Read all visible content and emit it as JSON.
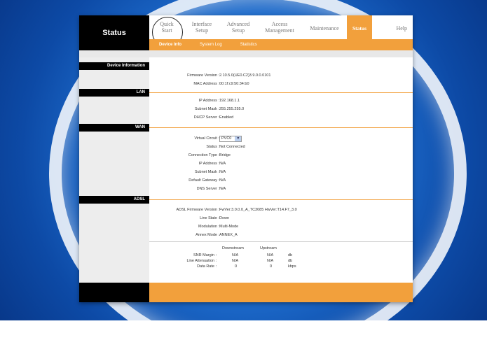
{
  "header": {
    "status_box": "Status",
    "tabs": [
      {
        "line1": "Quick",
        "line2": "Start"
      },
      {
        "line1": "Interface",
        "line2": "Setup"
      },
      {
        "line1": "Advanced",
        "line2": "Setup"
      },
      {
        "line1": "Access",
        "line2": "Management"
      },
      {
        "line1": "Maintenance",
        "line2": ""
      },
      {
        "line1": "Status",
        "line2": ""
      },
      {
        "line1": "Help",
        "line2": ""
      }
    ],
    "subtabs": [
      "Device Info",
      "System Log",
      "Statistics"
    ]
  },
  "device_info": {
    "section": "Device Information",
    "firmware_label": "Firmware Version :",
    "firmware_value": "2.10.5.0(UE0.C2)3.9.0.0.0101",
    "mac_label": "MAC Address :",
    "mac_value": "00:1f:c9:50:34:b0"
  },
  "lan": {
    "section": "LAN",
    "ip_label": "IP Address :",
    "ip_value": "192.168.1.1",
    "mask_label": "Subnet Mask :",
    "mask_value": "255.255.255.0",
    "dhcp_label": "DHCP Server :",
    "dhcp_value": "Enabled"
  },
  "wan": {
    "section": "WAN",
    "vc_label": "Virtual Circuit :",
    "vc_value": "PVC0",
    "status_label": "Status :",
    "status_value": "Not Connected",
    "conn_label": "Connection Type :",
    "conn_value": "Bridge",
    "ip_label": "IP Address :",
    "ip_value": "N/A",
    "mask_label": "Subnet Mask :",
    "mask_value": "N/A",
    "gw_label": "Default Gateway :",
    "gw_value": "N/A",
    "dns_label": "DNS Server :",
    "dns_value": "N/A"
  },
  "adsl": {
    "section": "ADSL",
    "fw_label": "ADSL Firmware Version :",
    "fw_value": "FwVer:3.0.0.0_A_TC3085 HwVer:T14.F7_3.0",
    "line_label": "Line State :",
    "line_value": "Down",
    "mod_label": "Modulation :",
    "mod_value": "Multi-Mode",
    "annex_label": "Annex Mode :",
    "annex_value": "ANNEX_A",
    "col_down": "Downstream",
    "col_up": "Upstream",
    "stats": [
      {
        "label": "SNR Margin :",
        "down": "N/A",
        "up": "N/A",
        "unit": "db"
      },
      {
        "label": "Line Attenuation :",
        "down": "N/A",
        "up": "N/A",
        "unit": "db"
      },
      {
        "label": "Data Rate :",
        "down": "0",
        "up": "0",
        "unit": "kbps"
      }
    ]
  }
}
